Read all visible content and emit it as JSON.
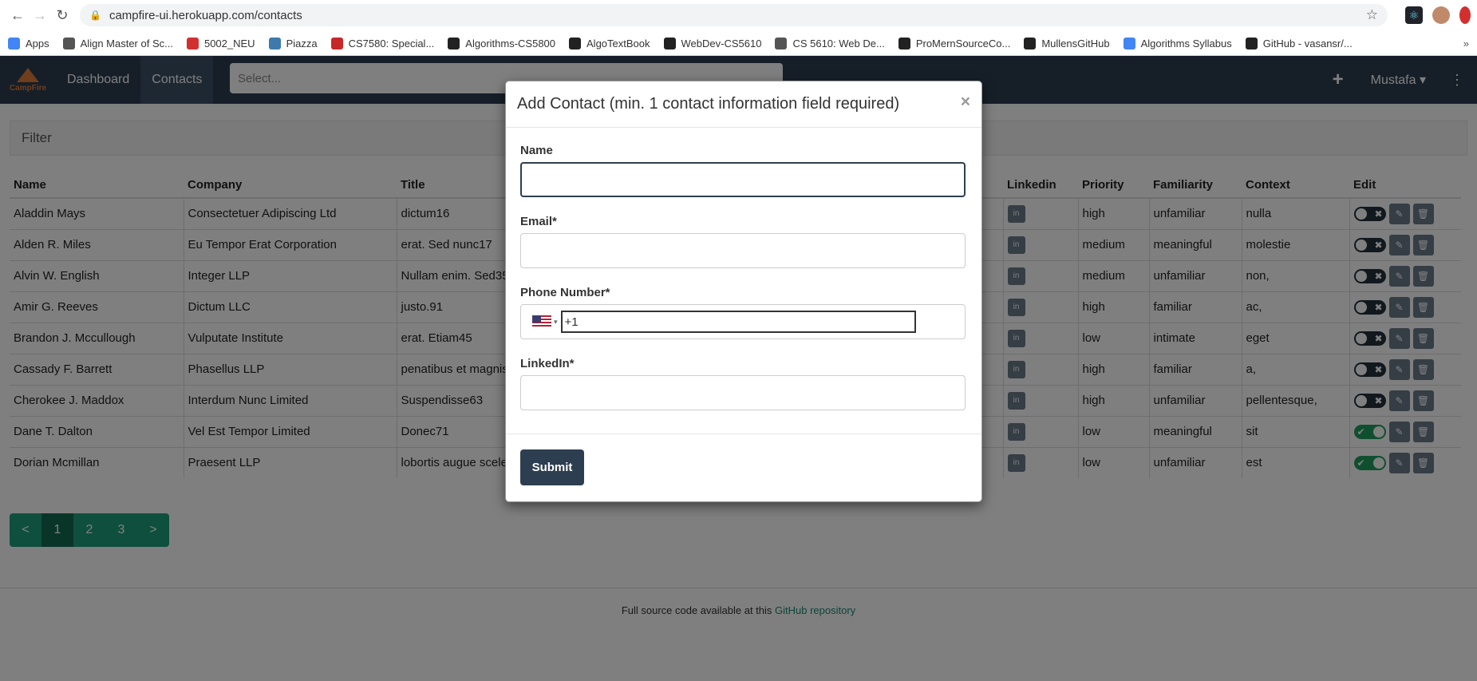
{
  "browser": {
    "url": "campfire-ui.herokuapp.com/contacts",
    "bookmarks": [
      {
        "label": "Apps",
        "icon": "apps-grid-icon",
        "color": "#4285f4"
      },
      {
        "label": "Align Master of Sc...",
        "icon": "globe-icon",
        "color": "#555555"
      },
      {
        "label": "5002_NEU",
        "icon": "circle-icon",
        "color": "#d32f2f"
      },
      {
        "label": "Piazza",
        "icon": "piazza-icon",
        "color": "#3e7aab"
      },
      {
        "label": "CS7580: Special...",
        "icon": "n-logo-icon",
        "color": "#c62828"
      },
      {
        "label": "Algorithms-CS5800",
        "icon": "blackboard-icon",
        "color": "#222222"
      },
      {
        "label": "AlgoTextBook",
        "icon": "github-icon",
        "color": "#222222"
      },
      {
        "label": "WebDev-CS5610",
        "icon": "blackboard-icon",
        "color": "#222222"
      },
      {
        "label": "CS 5610: Web De...",
        "icon": "globe-icon",
        "color": "#555555"
      },
      {
        "label": "ProMernSourceCo...",
        "icon": "github-icon",
        "color": "#222222"
      },
      {
        "label": "MullensGitHub",
        "icon": "github-icon",
        "color": "#222222"
      },
      {
        "label": "Algorithms Syllabus",
        "icon": "docs-icon",
        "color": "#4285f4"
      },
      {
        "label": "GitHub - vasansr/...",
        "icon": "github-icon",
        "color": "#222222"
      }
    ],
    "more": "»"
  },
  "nav": {
    "brand": "CampFire",
    "links": [
      "Dashboard",
      "Contacts"
    ],
    "search_placeholder": "Select...",
    "user": "Mustafa ▾",
    "plus": "+",
    "dots": "⋮"
  },
  "filter_label": "Filter",
  "table": {
    "headers": [
      "Name",
      "Company",
      "Title",
      "Linkedin",
      "Priority",
      "Familiarity",
      "Context",
      "Edit"
    ],
    "rows": [
      {
        "name": "Aladdin Mays",
        "company": "Consectetuer Adipiscing Ltd",
        "title": "dictum16",
        "priority": "high",
        "familiarity": "unfamiliar",
        "context": "nulla",
        "active": false
      },
      {
        "name": "Alden R. Miles",
        "company": "Eu Tempor Erat Corporation",
        "title": "erat. Sed nunc17",
        "priority": "medium",
        "familiarity": "meaningful",
        "context": "molestie",
        "active": false
      },
      {
        "name": "Alvin W. English",
        "company": "Integer LLP",
        "title": "Nullam enim. Sed35",
        "priority": "medium",
        "familiarity": "unfamiliar",
        "context": "non,",
        "active": false
      },
      {
        "name": "Amir G. Reeves",
        "company": "Dictum LLC",
        "title": "justo.91",
        "priority": "high",
        "familiarity": "familiar",
        "context": "ac,",
        "active": false
      },
      {
        "name": "Brandon J. Mccullough",
        "company": "Vulputate Institute",
        "title": "erat. Etiam45",
        "priority": "low",
        "familiarity": "intimate",
        "context": "eget",
        "active": false
      },
      {
        "name": "Cassady F. Barrett",
        "company": "Phasellus LLP",
        "title": "penatibus et magnis",
        "priority": "high",
        "familiarity": "familiar",
        "context": "a,",
        "active": false
      },
      {
        "name": "Cherokee J. Maddox",
        "company": "Interdum Nunc Limited",
        "title": "Suspendisse63",
        "priority": "high",
        "familiarity": "unfamiliar",
        "context": "pellentesque,",
        "active": false
      },
      {
        "name": "Dane T. Dalton",
        "company": "Vel Est Tempor Limited",
        "title": "Donec71",
        "priority": "low",
        "familiarity": "meaningful",
        "context": "sit",
        "active": true
      },
      {
        "name": "Dorian Mcmillan",
        "company": "Praesent LLP",
        "title": "lobortis augue scele",
        "priority": "low",
        "familiarity": "unfamiliar",
        "context": "est",
        "active": true
      }
    ]
  },
  "pagination": {
    "prev": "<",
    "pages": [
      "1",
      "2",
      "3"
    ],
    "next": ">",
    "current": "1"
  },
  "footer": {
    "text": "Full source code available at this ",
    "link": "GitHub repository"
  },
  "modal": {
    "title": "Add Contact (min. 1 contact information field required)",
    "close": "×",
    "name_label": "Name",
    "name_value": "",
    "email_label": "Email*",
    "email_value": "",
    "phone_label": "Phone Number*",
    "phone_value": "+1",
    "phone_country": "US",
    "linkedin_label": "LinkedIn*",
    "linkedin_value": "",
    "submit": "Submit"
  },
  "colors": {
    "navbar": "#2d3e50",
    "accent": "#1e9f7a",
    "toggle_on": "#1e9f5f"
  }
}
